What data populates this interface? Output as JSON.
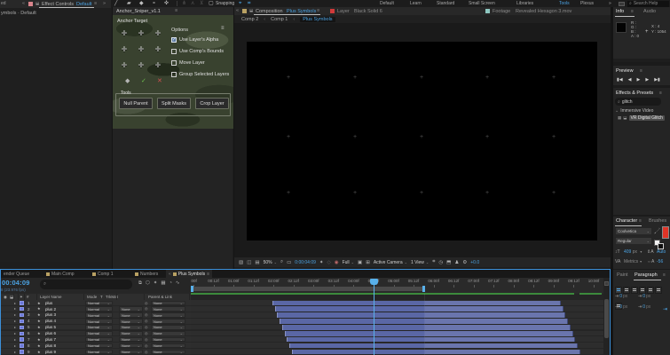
{
  "colors": {
    "accent_blue": "#4ba3e3",
    "focus_border": "#3b8fd9",
    "bar_blue": "#5a67a5",
    "bar_blue_light": "#6a75ad",
    "green_render": "#3c8a3c",
    "layer_swatch": "#6b79d8",
    "comp_icon_tan": "#b9a163",
    "layer_icon_red": "#d03a3a",
    "footage_icon_teal": "#8ec7c0",
    "text_red_swatch": "#e03427"
  },
  "toolbar": {
    "tools": [
      {
        "glyph": "▲",
        "name": "selection-tool-icon",
        "active": true
      },
      {
        "glyph": "✛",
        "name": "hand-tool-icon"
      },
      {
        "glyph": "⌕",
        "name": "zoom-tool-icon"
      },
      {
        "glyph": "↻",
        "name": "rotate-tool-icon"
      },
      {
        "glyph": "⌖",
        "name": "camera-tool-icon"
      },
      {
        "glyph": "✚",
        "name": "pan-behind-tool-icon"
      },
      {
        "glyph": "⬚",
        "name": "shape-tool-icon"
      },
      {
        "glyph": "✎",
        "name": "pen-tool-icon"
      },
      {
        "glyph": "T",
        "name": "type-tool-icon"
      },
      {
        "glyph": "╱",
        "name": "brush-tool-icon"
      },
      {
        "glyph": "▰",
        "name": "clone-stamp-tool-icon"
      },
      {
        "glyph": "◆",
        "name": "eraser-tool-icon"
      },
      {
        "glyph": "⚬",
        "name": "roto-brush-tool-icon"
      },
      {
        "glyph": "✜",
        "name": "puppet-pin-tool-icon"
      }
    ],
    "disabled_tools": [
      {
        "glyph": "⋔",
        "name": "bone-tool-icon"
      },
      {
        "glyph": "⋏",
        "name": "bone-tool-2-icon"
      },
      {
        "glyph": "⊻",
        "name": "bone-tool-3-icon"
      }
    ],
    "snapping_label": "Snapping",
    "snap_icons": [
      {
        "glyph": "⌖",
        "name": "snap-to-edges-icon"
      },
      {
        "glyph": "⌗",
        "name": "snap-to-grid-icon"
      }
    ],
    "workspaces": [
      {
        "label": "Default"
      },
      {
        "label": "Learn"
      },
      {
        "label": "Standard"
      },
      {
        "label": "Small Screen"
      },
      {
        "label": "Libraries"
      },
      {
        "label": "Tools",
        "active": true
      },
      {
        "label": "Plexus"
      },
      {
        "label": "»"
      }
    ],
    "search_placeholder": "Search Help"
  },
  "effect_controls": {
    "edge_fragment": "ed",
    "collapse_chevron": "«",
    "tab_prefix": "Effect Controls",
    "tab_active": "Default",
    "menu_glyph": "≡",
    "expand_chevron": "»",
    "subtitle": "ymbols · Default"
  },
  "anchor_sniper": {
    "title": "Anchor_Sniper_v1.1",
    "menu_glyph": "≡",
    "anchor_target_label": "Anchor Target",
    "anchor_glyph": "✛",
    "options_label": "Options",
    "checkboxes": [
      {
        "label": "Use Layer's Alpha",
        "checked": true
      },
      {
        "label": "Use Comp's Bounds",
        "checked": false
      },
      {
        "label": "Move Layer",
        "checked": false
      },
      {
        "label": "Group Selected Layers",
        "checked": false
      }
    ],
    "confirm_row": [
      {
        "glyph": "◆",
        "name": "anchor-dot-icon",
        "color": "#b5b5b5"
      },
      {
        "glyph": "✓",
        "name": "apply-check-icon",
        "color": "#6fbf4f"
      },
      {
        "glyph": "✕",
        "name": "cancel-x-icon",
        "color": "#d05050"
      }
    ],
    "tools_label": "Tools",
    "buttons": [
      "Null Parent",
      "Split Masks",
      "Crop Layer"
    ]
  },
  "composition": {
    "collapse_chevron": "«",
    "tab_prefix": "Composition",
    "tab_name": "Plus Symbols",
    "menu_glyph": "≡",
    "layer_tab_prefix": "Layer",
    "layer_tab_name": "Black Solid 6",
    "footage_tab_prefix": "Footage",
    "footage_tab_name": "Revealed Hexagon 3.mov",
    "breadcrumb": [
      "Comp 2",
      "Comp 1",
      "Plus Symbols"
    ],
    "statusbar": [
      {
        "glyph": "▧",
        "name": "always-preview-icon"
      },
      {
        "glyph": "◫",
        "name": "main-viewer-icon"
      },
      {
        "glyph": "▤",
        "name": "pixel-aspect-icon"
      },
      {
        "text": "50%",
        "caret": true,
        "name": "magnification-select"
      },
      {
        "glyph": "⌕",
        "name": "magnify-icon"
      },
      {
        "glyph": "▭",
        "name": "rulers-icon"
      },
      {
        "text": "0:00:04:09",
        "blue": true,
        "name": "viewer-timecode"
      },
      {
        "glyph": "✦",
        "name": "snapshot-icon"
      },
      {
        "glyph": "◇",
        "name": "show-snapshot-icon",
        "dim": true
      },
      {
        "glyph": "◉",
        "name": "channels-rgb-icon",
        "color": "#c06a6a"
      },
      {
        "text": "Full",
        "caret": true,
        "name": "resolution-select"
      },
      {
        "glyph": "▣",
        "name": "region-of-interest-icon"
      },
      {
        "glyph": "⊞",
        "name": "transparency-grid-icon"
      },
      {
        "text": "Active Camera",
        "caret": true,
        "name": "camera-select"
      },
      {
        "text": "1 View",
        "caret": true,
        "name": "view-layout-select"
      },
      {
        "glyph": "⌗",
        "name": "share-view-icon"
      },
      {
        "glyph": "◷",
        "name": "preview-time-icon"
      },
      {
        "glyph": "⬒",
        "name": "fast-previews-icon"
      },
      {
        "glyph": "♟",
        "name": "workspace-pixel-icon"
      },
      {
        "glyph": "⚙",
        "name": "settings-gear-icon"
      },
      {
        "text": "+0.0",
        "blue": true,
        "name": "exposure-value"
      }
    ]
  },
  "info_panel": {
    "tab_info": "Info",
    "tab_audio": "Audio",
    "menu_glyph": "≡",
    "rgba_lines": [
      "R :",
      "G :",
      "B :",
      "A : 0"
    ],
    "x_value": "X : 4",
    "y_value": "Y : 1054"
  },
  "preview_panel": {
    "title": "Preview",
    "menu_glyph": "≡",
    "buttons": [
      {
        "glyph": "▮◀",
        "name": "first-frame-button"
      },
      {
        "glyph": "◀",
        "name": "prev-frame-button"
      },
      {
        "glyph": "▶",
        "name": "play-button"
      },
      {
        "glyph": "▶",
        "name": "next-frame-button"
      },
      {
        "glyph": "▶▮",
        "name": "last-frame-button"
      }
    ]
  },
  "effects_presets": {
    "title": "Effects & Presets",
    "menu_glyph": "≡",
    "search_value": "glitch",
    "group_label": "Immersive Video",
    "item_label": "VR Digital Glitch",
    "item_icons": [
      {
        "glyph": "▦",
        "name": "effect-32bpc-icon"
      },
      {
        "glyph": "⬓",
        "name": "effect-gpu-icon"
      }
    ]
  },
  "character_panel": {
    "tab_character": "Character",
    "tab_brushes": "Brushes",
    "menu_glyph": "≡",
    "font_family": "Coolvetica",
    "font_style": "Regular",
    "size_value": "409",
    "size_unit": "px",
    "leading_value": "Auto",
    "kerning_label": "Metrics",
    "tracking_value": "-56"
  },
  "paragraph_panel": {
    "tab_paint": "Paint",
    "tab_paragraph": "Paragraph",
    "menu_glyph": "≡",
    "align_count": 7,
    "fields": [
      {
        "value": "0",
        "unit": "px",
        "name": "indent-left-field"
      },
      {
        "value": "0",
        "unit": "px",
        "name": "indent-right-field"
      },
      {
        "value": "0",
        "unit": "px",
        "name": "space-before-field"
      },
      {
        "value": "0",
        "unit": "px",
        "name": "space-after-field"
      }
    ]
  },
  "timeline": {
    "tabs": [
      {
        "label": "ender Queue",
        "icon": false
      },
      {
        "label": "Main Comp",
        "icon": true
      },
      {
        "label": "Comp 1",
        "icon": true
      },
      {
        "label": "Numbers",
        "icon": true
      },
      {
        "label": "Plus Symbols",
        "icon": true,
        "active": true
      }
    ],
    "timecode": "00:04:09",
    "fps_line": "8 (23.976 fps)",
    "search_icon": "⌕",
    "switch_icons": [
      {
        "glyph": "⧉",
        "name": "comp-mini-flowchart-icon"
      },
      {
        "glyph": "⬡",
        "name": "draft-3d-icon"
      },
      {
        "glyph": "✦",
        "name": "hide-shy-icon"
      },
      {
        "glyph": "▦",
        "name": "frame-blending-icon"
      },
      {
        "glyph": "◔",
        "name": "motion-blur-icon"
      },
      {
        "glyph": "∿",
        "name": "graph-editor-icon"
      }
    ],
    "columns": {
      "eye": "◉",
      "audio": "⬓",
      "shy": "✦",
      "num": "#",
      "layer_name": "Layer Name",
      "mode": "Mode",
      "t": "T",
      "trkmat": "TrkMat",
      "parent": "Parent & Link"
    },
    "ruler_labels": [
      ":00f",
      "00:12f",
      "01:00f",
      "01:12f",
      "02:00f",
      "02:12f",
      "03:00f",
      "03:12f",
      "04:00f",
      "04:12f",
      "05:00f",
      "05:12f",
      "06:00f",
      "06:12f",
      "07:00f",
      "07:12f",
      "08:00f",
      "08:12f",
      "09:00f",
      "09:12f",
      "10:00f"
    ],
    "layers": [
      {
        "num": "1",
        "name": "plus",
        "mode": "Normal",
        "trkmat": null,
        "parent": "None"
      },
      {
        "num": "2",
        "name": "plus 2",
        "mode": "Normal",
        "trkmat": "None",
        "parent": "None"
      },
      {
        "num": "3",
        "name": "plus 3",
        "mode": "Normal",
        "trkmat": "None",
        "parent": "None"
      },
      {
        "num": "4",
        "name": "plus 4",
        "mode": "Normal",
        "trkmat": "None",
        "parent": "None"
      },
      {
        "num": "5",
        "name": "plus 5",
        "mode": "Normal",
        "trkmat": "None",
        "parent": "None"
      },
      {
        "num": "6",
        "name": "plus 6",
        "mode": "Normal",
        "trkmat": "None",
        "parent": "None"
      },
      {
        "num": "7",
        "name": "plus 7",
        "mode": "Normal",
        "trkmat": "None",
        "parent": "None"
      },
      {
        "num": "8",
        "name": "plus 8",
        "mode": "Normal",
        "trkmat": "None",
        "parent": "None"
      },
      {
        "num": "9",
        "name": "plus 9",
        "mode": "Normal",
        "trkmat": "None",
        "parent": "None"
      }
    ]
  }
}
